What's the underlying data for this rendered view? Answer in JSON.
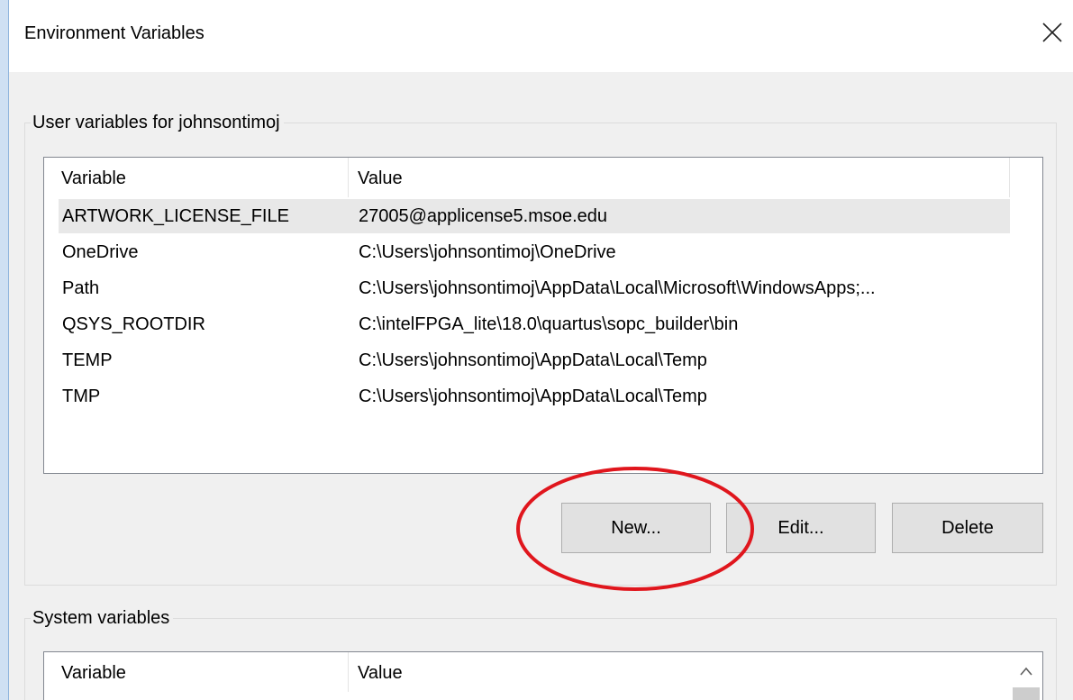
{
  "window": {
    "title": "Environment Variables"
  },
  "user_group": {
    "legend": "User variables for johnsontimoj",
    "columns": {
      "variable": "Variable",
      "value": "Value"
    },
    "rows": [
      {
        "variable": "ARTWORK_LICENSE_FILE",
        "value": "27005@applicense5.msoe.edu",
        "selected": true
      },
      {
        "variable": "OneDrive",
        "value": "C:\\Users\\johnsontimoj\\OneDrive"
      },
      {
        "variable": "Path",
        "value": "C:\\Users\\johnsontimoj\\AppData\\Local\\Microsoft\\WindowsApps;..."
      },
      {
        "variable": "QSYS_ROOTDIR",
        "value": "C:\\intelFPGA_lite\\18.0\\quartus\\sopc_builder\\bin"
      },
      {
        "variable": "TEMP",
        "value": "C:\\Users\\johnsontimoj\\AppData\\Local\\Temp"
      },
      {
        "variable": "TMP",
        "value": "C:\\Users\\johnsontimoj\\AppData\\Local\\Temp"
      }
    ],
    "buttons": {
      "new": "New...",
      "edit": "Edit...",
      "delete": "Delete"
    }
  },
  "system_group": {
    "legend": "System variables",
    "columns": {
      "variable": "Variable",
      "value": "Value"
    }
  },
  "annotation": {
    "color": "#e0161d",
    "target": "New..."
  },
  "icons": {
    "close": "close-icon",
    "scroll_up": "chevron-up-icon"
  }
}
